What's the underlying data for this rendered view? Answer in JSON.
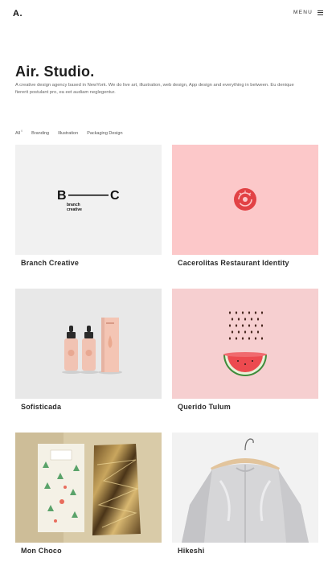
{
  "header": {
    "logo": "A.",
    "menu_label": "MENU"
  },
  "hero": {
    "title": "Air. Studio.",
    "description": "A creative design agency based in NewYork. We do live art, illustration, web design, App design and everything in between. Eu denique fiererit postulant pro, ea eet audiam neglegentur."
  },
  "filters": [
    {
      "label": "All",
      "count": "6"
    },
    {
      "label": "Branding"
    },
    {
      "label": "Illustration"
    },
    {
      "label": "Packaging Design"
    }
  ],
  "projects": [
    {
      "title": "Branch Creative",
      "logo_left": "B",
      "logo_right": "C",
      "logo_sub_1": "branch",
      "logo_sub_2": "creative"
    },
    {
      "title": "Cacerolitas Restaurant Identity"
    },
    {
      "title": "Sofisticada"
    },
    {
      "title": "Querido Tulum"
    },
    {
      "title": "Mon Choco"
    },
    {
      "title": "Hikeshi"
    }
  ],
  "colors": {
    "accent_red": "#e24245",
    "pink": "#fcc8c9",
    "grey": "#f1f1f1"
  }
}
